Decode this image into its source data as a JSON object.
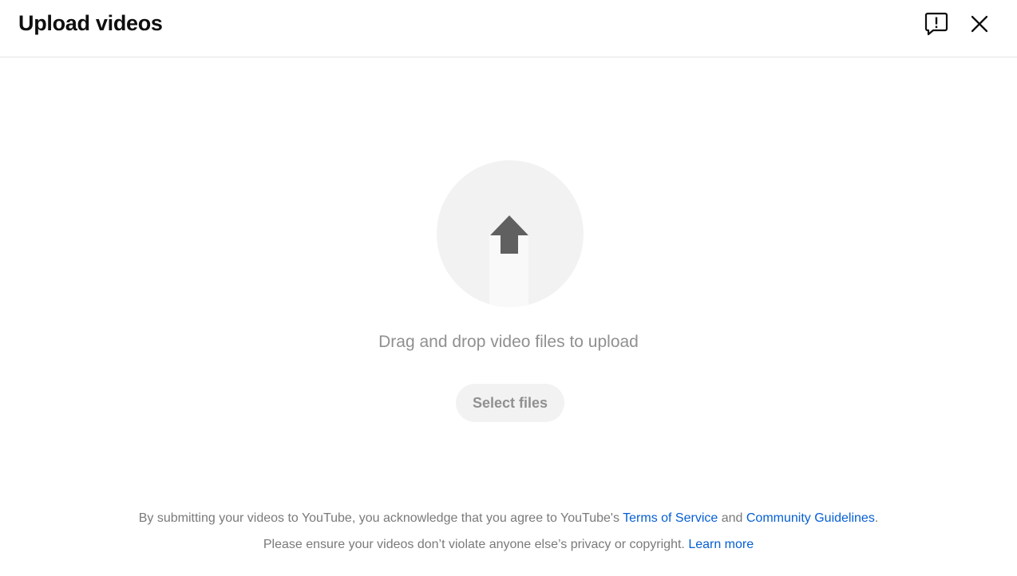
{
  "header": {
    "title": "Upload videos",
    "feedback_icon": "feedback-exclamation-icon",
    "close_icon": "close-x-icon"
  },
  "dropzone": {
    "icon": "upload-arrow-icon",
    "text": "Drag and drop video files to upload",
    "select_label": "Select files"
  },
  "legal": {
    "line1_prefix": "By submitting your videos to YouTube, you acknowledge that you agree to YouTube's ",
    "terms_link": "Terms of Service",
    "and_text": " and ",
    "guidelines_link": "Community Guidelines",
    "line1_suffix": ".",
    "line2_prefix": "Please ensure your videos don’t violate anyone else’s privacy or copyright. ",
    "learn_more_link": "Learn more"
  },
  "colors": {
    "link": "#065fd4",
    "muted_text": "#909090",
    "circle_bg": "#f2f2f2",
    "arrow": "#606060"
  }
}
